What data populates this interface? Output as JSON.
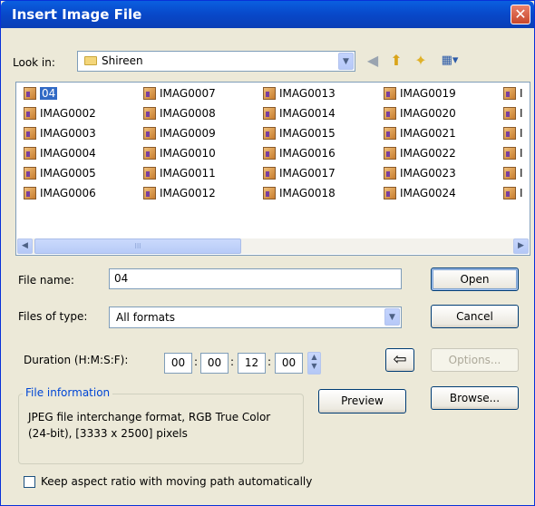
{
  "window": {
    "title": "Insert Image File",
    "close_glyph": "✕"
  },
  "look_in": {
    "label": "Look in:",
    "value": "Shireen"
  },
  "toolbar": {
    "back_glyph": "◀",
    "up_glyph": "⬆",
    "new_folder_glyph": "✦",
    "view_glyph": "▦▾"
  },
  "files": {
    "columns": [
      [
        "04",
        "IMAG0002",
        "IMAG0003",
        "IMAG0004",
        "IMAG0005",
        "IMAG0006"
      ],
      [
        "IMAG0007",
        "IMAG0008",
        "IMAG0009",
        "IMAG0010",
        "IMAG0011",
        "IMAG0012"
      ],
      [
        "IMAG0013",
        "IMAG0014",
        "IMAG0015",
        "IMAG0016",
        "IMAG0017",
        "IMAG0018"
      ],
      [
        "IMAG0019",
        "IMAG0020",
        "IMAG0021",
        "IMAG0022",
        "IMAG0023",
        "IMAG0024"
      ],
      [
        "I",
        "I",
        "I",
        "I",
        "I",
        "I"
      ]
    ],
    "selected": "04"
  },
  "file_name": {
    "label": "File name:",
    "value": "04"
  },
  "files_of_type": {
    "label": "Files of type:",
    "value": "All formats"
  },
  "duration": {
    "label": "Duration (H:M:S:F):",
    "h": "00",
    "m": "00",
    "s": "12",
    "f": "00",
    "sep": ":"
  },
  "buttons": {
    "open": "Open",
    "cancel": "Cancel",
    "options": "Options...",
    "preview": "Preview",
    "browse": "Browse...",
    "arrow_glyph": "⇦"
  },
  "file_info": {
    "label": "File information",
    "text": "JPEG file interchange format,  RGB True Color (24-bit),  [3333 x 2500] pixels"
  },
  "keep_aspect": {
    "label": "Keep aspect ratio with moving path automatically",
    "checked": false
  },
  "scroll": {
    "left": "◀",
    "right": "▶",
    "grip": "III",
    "drop": "▼"
  }
}
